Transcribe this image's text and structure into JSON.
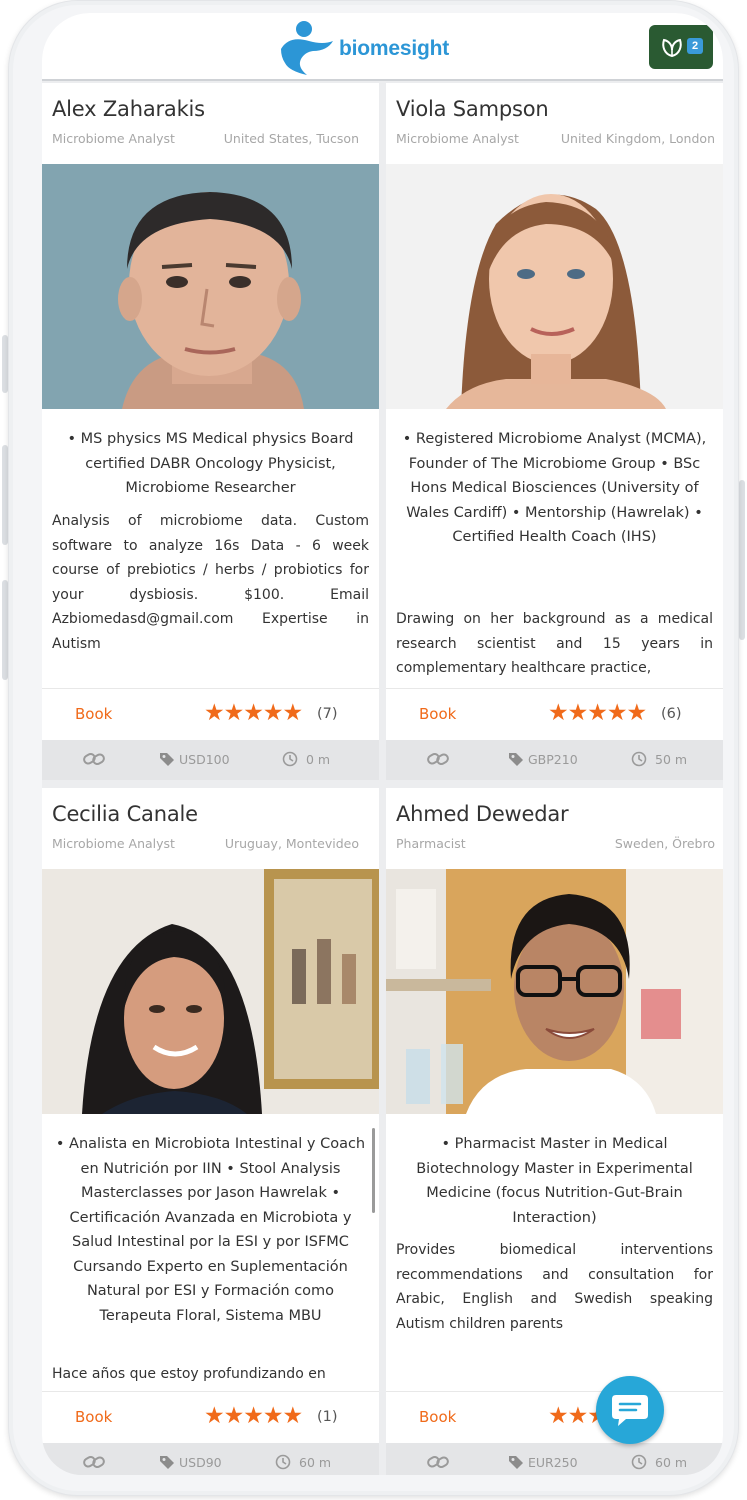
{
  "app": {
    "brand": "biomesight",
    "notification_count": "2",
    "colors": {
      "accent": "#f06a1a",
      "brand": "#2c96d6",
      "badge": "#2a5a32"
    }
  },
  "practitioners": [
    {
      "name": "Alex Zaharakis",
      "role": "Microbiome Analyst",
      "location": "United States, Tucson",
      "qualifications": "• MS physics MS Medical physics Board certified DABR Oncology Physicist, Microbiome Researcher",
      "description": "Analysis of microbiome data. Custom software to analyze 16s Data - 6 week course of prebiotics / herbs / probiotics for your dysbiosis. $100. Email Azbiomedasd@gmail.com Expertise in Autism",
      "book_label": "Book",
      "stars": "★★★★★",
      "rating": 5,
      "review_count": "(7)",
      "price": "USD100",
      "duration": "0 m"
    },
    {
      "name": "Viola Sampson",
      "role": "Microbiome Analyst",
      "location": "United Kingdom, London",
      "qualifications": "• Registered Microbiome Analyst (MCMA), Founder of The Microbiome Group • BSc Hons Medical Biosciences (University of Wales Cardiff) • Mentorship (Hawrelak) • Certified Health Coach (IHS)",
      "description": "Drawing on her background as a medical research scientist and 15 years in complementary healthcare practice,",
      "book_label": "Book",
      "stars": "★★★★★",
      "rating": 5,
      "review_count": "(6)",
      "price": "GBP210",
      "duration": "50 m"
    },
    {
      "name": "Cecilia Canale",
      "role": "Microbiome Analyst",
      "location": "Uruguay, Montevideo",
      "qualifications": "• Analista en Microbiota Intestinal y Coach en Nutrición por IIN • Stool Analysis Masterclasses por Jason Hawrelak • Certificación Avanzada en Microbiota y Salud Intestinal por la ESI y por ISFMC Cursando Experto en Suplementación Natural por ESI y Formación como Terapeuta Floral, Sistema MBU",
      "description": "Hace años que estoy profundizando en",
      "book_label": "Book",
      "stars": "★★★★★",
      "rating": 5,
      "review_count": "(1)",
      "price": "USD90",
      "duration": "60 m"
    },
    {
      "name": "Ahmed Dewedar",
      "role": "Pharmacist",
      "location": "Sweden, Örebro",
      "qualifications": "• Pharmacist Master in Medical Biotechnology Master in Experimental Medicine (focus Nutrition-Gut-Brain Interaction)",
      "description": "Provides biomedical interventions recommendations and consultation for Arabic, English and Swedish speaking Autism children parents",
      "book_label": "Book",
      "stars": "★★★★★",
      "rating": 5,
      "review_count": "",
      "price": "EUR250",
      "duration": "60 m"
    }
  ]
}
